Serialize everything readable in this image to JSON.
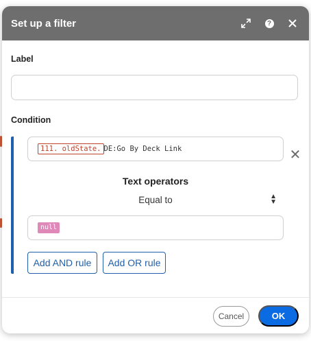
{
  "dialog": {
    "title": "Set up a filter",
    "icons": [
      "expand-icon",
      "help-icon",
      "close-icon"
    ],
    "help_glyph": "?"
  },
  "label_section": {
    "heading": "Label",
    "value": ""
  },
  "condition_section": {
    "heading": "Condition",
    "field": {
      "variable_pill": "111. oldState.",
      "text": "DE:Go By Deck Link"
    },
    "operator_group_title": "Text operators",
    "operator": "Equal to",
    "value_pill": "null",
    "add_and_label": "Add AND rule",
    "add_or_label": "Add OR rule"
  },
  "footer": {
    "cancel_label": "Cancel",
    "ok_label": "OK"
  },
  "colors": {
    "header_bg": "#6e6e6e",
    "accent_blue": "#1f5fab",
    "ok_blue": "#0a6be3",
    "variable_pill": "#c0432b",
    "null_pill": "#e089b9"
  }
}
